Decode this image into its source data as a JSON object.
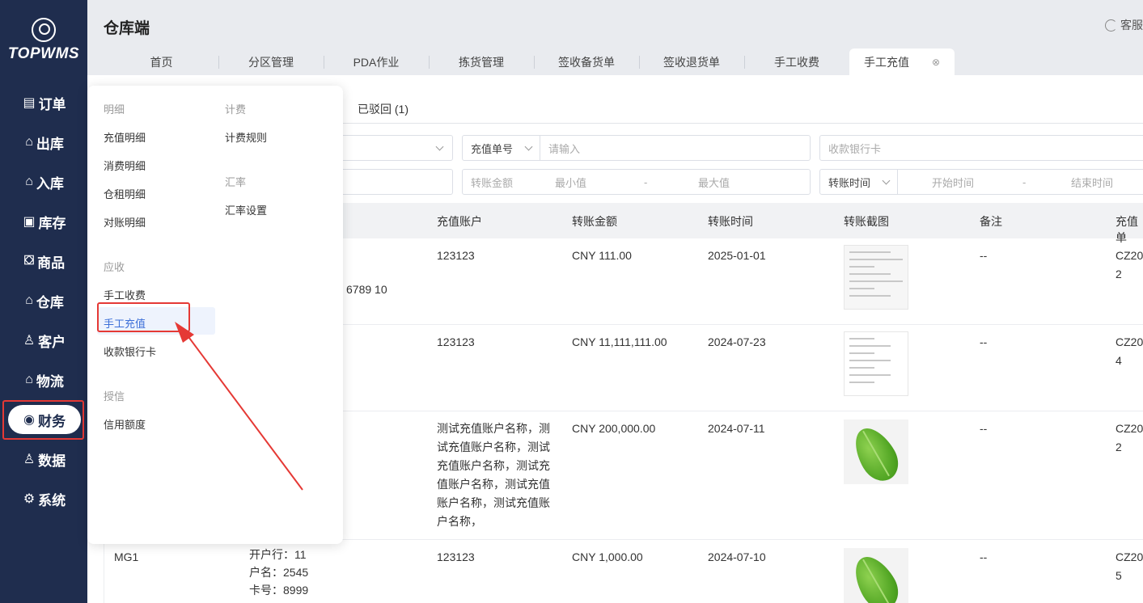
{
  "app": {
    "logo_text": "TOPWMS",
    "title": "仓库端",
    "service_label": "客服"
  },
  "sidebar": {
    "items": [
      {
        "icon": "order-icon",
        "glyph": "▤",
        "label": "订单"
      },
      {
        "icon": "outbound-icon",
        "glyph": "⌂",
        "label": "出库"
      },
      {
        "icon": "inbound-icon",
        "glyph": "⌂",
        "label": "入库"
      },
      {
        "icon": "inventory-icon",
        "glyph": "▣",
        "label": "库存"
      },
      {
        "icon": "goods-icon",
        "glyph": "⛋",
        "label": "商品"
      },
      {
        "icon": "warehouse-icon",
        "glyph": "⌂",
        "label": "仓库"
      },
      {
        "icon": "customer-icon",
        "glyph": "♙",
        "label": "客户"
      },
      {
        "icon": "logistics-icon",
        "glyph": "⌂",
        "label": "物流"
      },
      {
        "icon": "finance-icon",
        "glyph": "◉",
        "label": "财务",
        "active": true
      },
      {
        "icon": "data-icon",
        "glyph": "♙",
        "label": "数据"
      },
      {
        "icon": "system-icon",
        "glyph": "⚙",
        "label": "系统"
      }
    ]
  },
  "tabs": [
    {
      "label": "首页"
    },
    {
      "label": "分区管理"
    },
    {
      "label": "PDA作业"
    },
    {
      "label": "拣货管理"
    },
    {
      "label": "签收备货单"
    },
    {
      "label": "签收退货单"
    },
    {
      "label": "手工收费"
    },
    {
      "label": "手工充值",
      "active": true,
      "close": "⊗"
    }
  ],
  "status_tab": "已驳回 (1)",
  "filters": {
    "charge_no_label": "充值单号",
    "charge_no_placeholder": "请输入",
    "bank_card_placeholder": "收款银行卡",
    "amount_label": "转账金额",
    "amount_min": "最小值",
    "amount_dash": "-",
    "amount_max": "最大值",
    "time_label": "转账时间",
    "time_start": "开始时间",
    "time_dash": "-",
    "time_end": "结束时间"
  },
  "table": {
    "headers": [
      "充值账户",
      "转账金额",
      "转账时间",
      "转账截图",
      "备注",
      "充值单"
    ],
    "rows": [
      {
        "col1_fragment": "6789 10",
        "account": "123123",
        "amount": "CNY 111.00",
        "time": "2025-01-01",
        "shot": "doc",
        "note": "--",
        "no_line1": "CZ20",
        "no_line2": "2"
      },
      {
        "account": "123123",
        "amount": "CNY 11,111,111.00",
        "time": "2024-07-23",
        "shot": "doc",
        "note": "--",
        "no_line1": "CZ20",
        "no_line2": "4"
      },
      {
        "account_lines": [
          "测试充值账户名称，测",
          "试充值账户名称，测试",
          "充值账户名称，测试充",
          "值账户名称，测试充值",
          "账户名称，测试充值账",
          "户名称，"
        ],
        "amount": "CNY 200,000.00",
        "time": "2024-07-11",
        "shot": "leaf",
        "note": "--",
        "no_line1": "CZ20",
        "no_line2": "2"
      },
      {
        "customer": "MG1",
        "bank_lines": [
          "开户行：11",
          "户名：2545",
          "卡号：8999"
        ],
        "account": "123123",
        "amount": "CNY 1,000.00",
        "time": "2024-07-10",
        "shot": "leaf",
        "note": "--",
        "no_line1": "CZ20",
        "no_line2": "5"
      }
    ]
  },
  "menu": {
    "groups": {
      "detail": "明细",
      "billing": "计费",
      "exchange": "汇率",
      "receivable": "应收",
      "credit": "授信"
    },
    "items": {
      "recharge_detail": "充值明细",
      "consume_detail": "消费明细",
      "rent_detail": "仓租明细",
      "reconcile_detail": "对账明细",
      "billing_rule": "计费规则",
      "exchange_setting": "汇率设置",
      "manual_fee": "手工收费",
      "manual_recharge": "手工充值",
      "bank_card": "收款银行卡",
      "credit_limit": "信用额度"
    }
  }
}
